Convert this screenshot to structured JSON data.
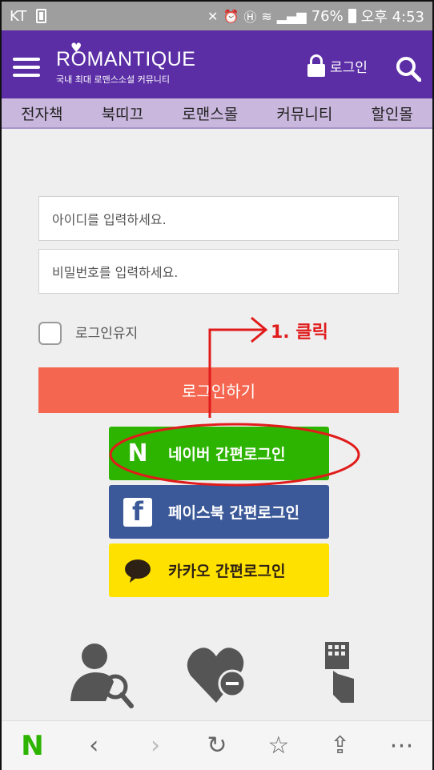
{
  "status_bar": {
    "carrier": "KT",
    "battery_percent": "76%",
    "time": "오후 4:53",
    "icons": [
      "sim-icon",
      "mute-icon",
      "alarm-icon",
      "hd-icon",
      "wifi-icon",
      "signal-icon",
      "battery-icon"
    ]
  },
  "header": {
    "logo_text": "ROMANTIQUE",
    "logo_subtitle": "국내 최대 로맨스소설 커뮤니티",
    "login_label": "로그인",
    "menu_icon": "hamburger-icon",
    "search_icon": "search-icon"
  },
  "nav": {
    "items": [
      {
        "label": "전자책"
      },
      {
        "label": "북띠끄"
      },
      {
        "label": "로맨스몰"
      },
      {
        "label": "커뮤니티"
      },
      {
        "label": "할인몰"
      }
    ]
  },
  "login_form": {
    "id_placeholder": "아이디를 입력하세요.",
    "password_placeholder": "비밀번호를 입력하세요.",
    "keep_login_label": "로그인유지",
    "keep_login_checked": false,
    "submit_label": "로그인하기"
  },
  "social_login": {
    "naver_label": "네이버 간편로그인",
    "facebook_label": "페이스북 간편로그인",
    "kakao_label": "카카오 간편로그인"
  },
  "annotation": {
    "text": "1. 클릭",
    "color": "#e11b1b"
  },
  "footer_icons": [
    "find-account-icon",
    "withdraw-heart-icon",
    "keypad-touch-icon"
  ],
  "bottom_bar": {
    "items": [
      "naver-home-icon",
      "back-icon",
      "forward-icon",
      "refresh-icon",
      "bookmark-star-icon",
      "share-icon",
      "more-icon"
    ]
  },
  "colors": {
    "header": "#5b2ea6",
    "nav": "#c9b7dd",
    "login_button": "#f4664f",
    "naver": "#2db400",
    "facebook": "#3b5998",
    "kakao": "#ffe100"
  }
}
